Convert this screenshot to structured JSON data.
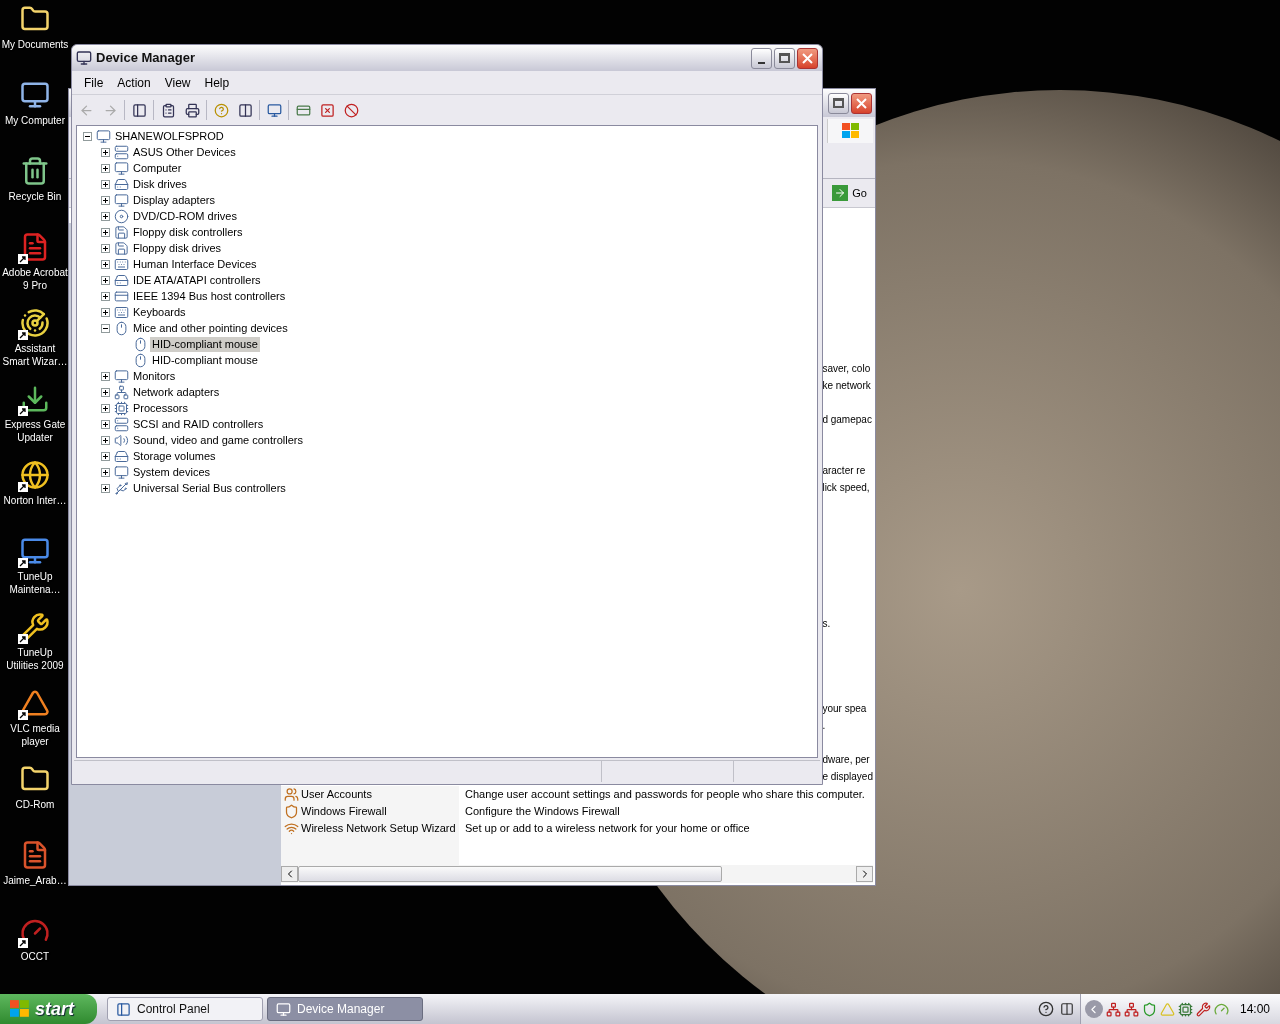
{
  "desktop_icons": [
    {
      "label": "My Documents",
      "shortcut": false
    },
    {
      "label": "My Computer",
      "shortcut": false
    },
    {
      "label": "Recycle Bin",
      "shortcut": false
    },
    {
      "label": "Adobe Acrobat 9 Pro",
      "shortcut": true
    },
    {
      "label": "Assistant Smart Wizar…",
      "shortcut": true
    },
    {
      "label": "Express Gate Updater",
      "shortcut": true
    },
    {
      "label": "Norton Inter…",
      "shortcut": true
    },
    {
      "label": "TuneUp Maintena…",
      "shortcut": true
    },
    {
      "label": "TuneUp Utilities 2009",
      "shortcut": true
    },
    {
      "label": "VLC media player",
      "shortcut": true
    },
    {
      "label": "CD-Rom",
      "shortcut": false
    },
    {
      "label": "Jaime_Arab…",
      "shortcut": false
    },
    {
      "label": "OCCT",
      "shortcut": true
    }
  ],
  "control_panel_window": {
    "go_button": "Go",
    "right_edge_texts": [
      "saver, colo",
      "ke network",
      "d gamepac",
      "aracter re",
      "lick speed,",
      "s.",
      "your spea",
      ".",
      "dware, per",
      "e displayed"
    ],
    "items": [
      {
        "name": "User Accounts",
        "description": "Change user account settings and passwords for people who share this computer."
      },
      {
        "name": "Windows Firewall",
        "description": "Configure the Windows Firewall"
      },
      {
        "name": "Wireless Network Setup Wizard",
        "description": "Set up or add to a wireless network for your home or office"
      }
    ]
  },
  "device_manager": {
    "title": "Device Manager",
    "menu": [
      "File",
      "Action",
      "View",
      "Help"
    ],
    "tree": [
      {
        "label": "SHANEWOLFSPROD",
        "expanded": true,
        "selected": false,
        "children": [
          {
            "label": "ASUS Other Devices",
            "expanded": false,
            "selected": false
          },
          {
            "label": "Computer",
            "expanded": false,
            "selected": false
          },
          {
            "label": "Disk drives",
            "expanded": false,
            "selected": false
          },
          {
            "label": "Display adapters",
            "expanded": false,
            "selected": false
          },
          {
            "label": "DVD/CD-ROM drives",
            "expanded": false,
            "selected": false
          },
          {
            "label": "Floppy disk controllers",
            "expanded": false,
            "selected": false
          },
          {
            "label": "Floppy disk drives",
            "expanded": false,
            "selected": false
          },
          {
            "label": "Human Interface Devices",
            "expanded": false,
            "selected": false
          },
          {
            "label": "IDE ATA/ATAPI controllers",
            "expanded": false,
            "selected": false
          },
          {
            "label": "IEEE 1394 Bus host controllers",
            "expanded": false,
            "selected": false
          },
          {
            "label": "Keyboards",
            "expanded": false,
            "selected": false
          },
          {
            "label": "Mice and other pointing devices",
            "expanded": true,
            "selected": false,
            "children": [
              {
                "label": "HID-compliant mouse",
                "selected": true
              },
              {
                "label": "HID-compliant mouse",
                "selected": false
              }
            ]
          },
          {
            "label": "Monitors",
            "expanded": false,
            "selected": false
          },
          {
            "label": "Network adapters",
            "expanded": false,
            "selected": false
          },
          {
            "label": "Processors",
            "expanded": false,
            "selected": false
          },
          {
            "label": "SCSI and RAID controllers",
            "expanded": false,
            "selected": false
          },
          {
            "label": "Sound, video and game controllers",
            "expanded": false,
            "selected": false
          },
          {
            "label": "Storage volumes",
            "expanded": false,
            "selected": false
          },
          {
            "label": "System devices",
            "expanded": false,
            "selected": false
          },
          {
            "label": "Universal Serial Bus controllers",
            "expanded": false,
            "selected": false
          }
        ]
      }
    ]
  },
  "taskbar": {
    "start": "start",
    "tasks": [
      {
        "label": "Control Panel",
        "selected": false
      },
      {
        "label": "Device Manager",
        "selected": true
      }
    ],
    "clock": "14:00"
  }
}
